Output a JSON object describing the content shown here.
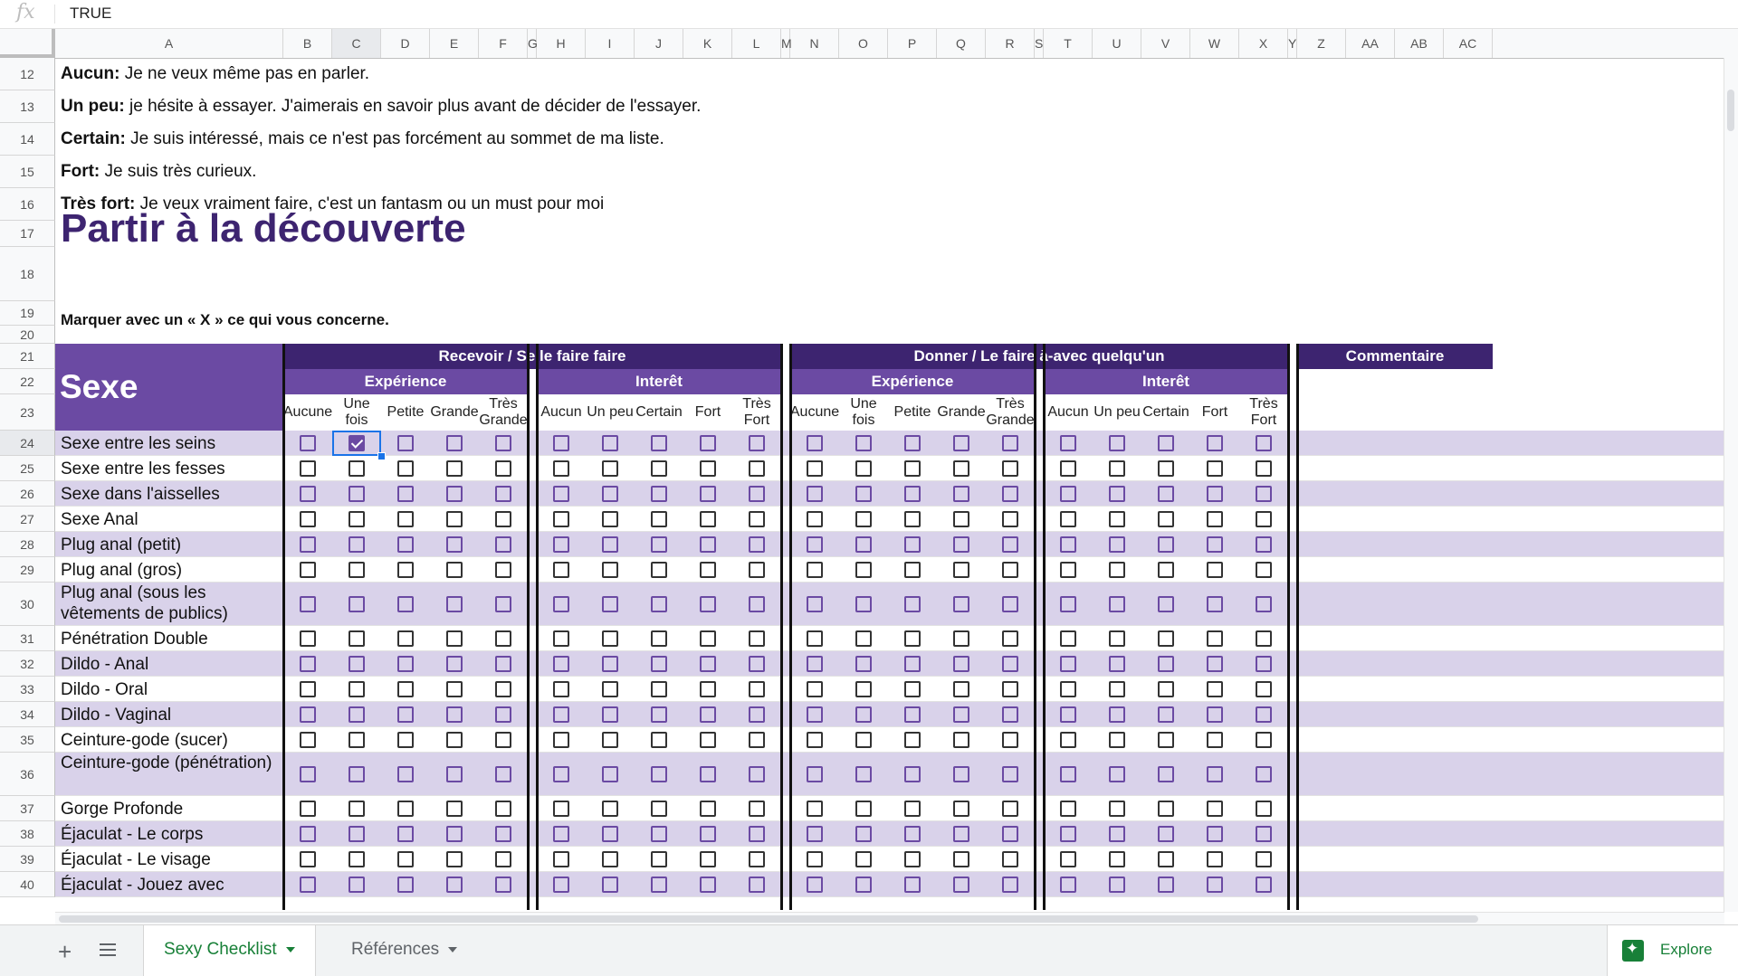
{
  "formula_bar": {
    "fx_label": "fx",
    "value": "TRUE"
  },
  "columns": [
    "A",
    "B",
    "C",
    "D",
    "E",
    "F",
    "G",
    "H",
    "I",
    "J",
    "K",
    "L",
    "M",
    "N",
    "O",
    "P",
    "Q",
    "R",
    "S",
    "T",
    "U",
    "V",
    "W",
    "X",
    "Y",
    "Z",
    "AA",
    "AB",
    "AC"
  ],
  "selected_column": "C",
  "legend_rows": [
    {
      "row": "12",
      "term": "Aucun:",
      "text": " Je ne veux même pas en parler."
    },
    {
      "row": "13",
      "term": "Un peu:",
      "text": " je hésite à essayer. J'aimerais en savoir plus avant de décider de l'essayer."
    },
    {
      "row": "14",
      "term": "Certain:",
      "text": " Je suis intéressé, mais ce n'est pas forcément au sommet de ma liste."
    },
    {
      "row": "15",
      "term": "Fort:",
      "text": " Je suis très curieux."
    },
    {
      "row": "16",
      "term": "Très fort:",
      "text": " Je veux vraiment faire, c'est un fantasm ou un must pour moi"
    }
  ],
  "row_17": "17",
  "section_title": {
    "row": "18",
    "text": "Partir à la découverte"
  },
  "instruction": {
    "row": "19",
    "text": "Marquer avec un « X » ce qui vous concerne."
  },
  "row_20": "20",
  "table": {
    "rows_header": [
      "21",
      "22",
      "23"
    ],
    "category": "Sexe",
    "group_receive": "Recevoir / Se le faire faire",
    "group_give": "Donner / Le faire à-avec quelqu'un",
    "group_comment": "Commentaire",
    "sub_experience": "Expérience",
    "sub_interest": "Interêt",
    "experience_cols": [
      "Aucune",
      "Une fois",
      "Petite",
      "Grande",
      "Très\nGrande"
    ],
    "interest_cols": [
      "Aucun",
      "Un peu",
      "Certain",
      "Fort",
      "Très\nFort"
    ],
    "items": [
      {
        "row": "24",
        "label": "Sexe entre les seins"
      },
      {
        "row": "25",
        "label": "Sexe entre les fesses"
      },
      {
        "row": "26",
        "label": "Sexe dans l'aisselles"
      },
      {
        "row": "27",
        "label": "Sexe Anal"
      },
      {
        "row": "28",
        "label": "Plug anal (petit)"
      },
      {
        "row": "29",
        "label": "Plug anal (gros)"
      },
      {
        "row": "30",
        "label": "Plug anal (sous les vêtements de publics)"
      },
      {
        "row": "31",
        "label": "Pénétration Double"
      },
      {
        "row": "32",
        "label": "Dildo - Anal"
      },
      {
        "row": "33",
        "label": "Dildo - Oral"
      },
      {
        "row": "34",
        "label": "Dildo - Vaginal"
      },
      {
        "row": "35",
        "label": "Ceinture-gode (sucer)"
      },
      {
        "row": "36",
        "label": "Ceinture-gode (pénétration)"
      },
      {
        "row": "37",
        "label": "Gorge Profonde"
      },
      {
        "row": "38",
        "label": "Éjaculat - Le corps"
      },
      {
        "row": "39",
        "label": "Éjaculat - Le visage"
      },
      {
        "row": "40",
        "label": "Éjaculat - Jouez avec"
      }
    ],
    "checked": [
      {
        "row": "24",
        "col": "C"
      }
    ]
  },
  "sheet_tabs": [
    {
      "label": "Sexy Checklist",
      "active": true
    },
    {
      "label": "Références",
      "active": false
    }
  ],
  "explore_label": "Explore",
  "colors": {
    "dark_purple": "#3d2470",
    "mid_purple": "#6b4aa3",
    "light_purple": "#d9d2ea",
    "green": "#188038"
  }
}
